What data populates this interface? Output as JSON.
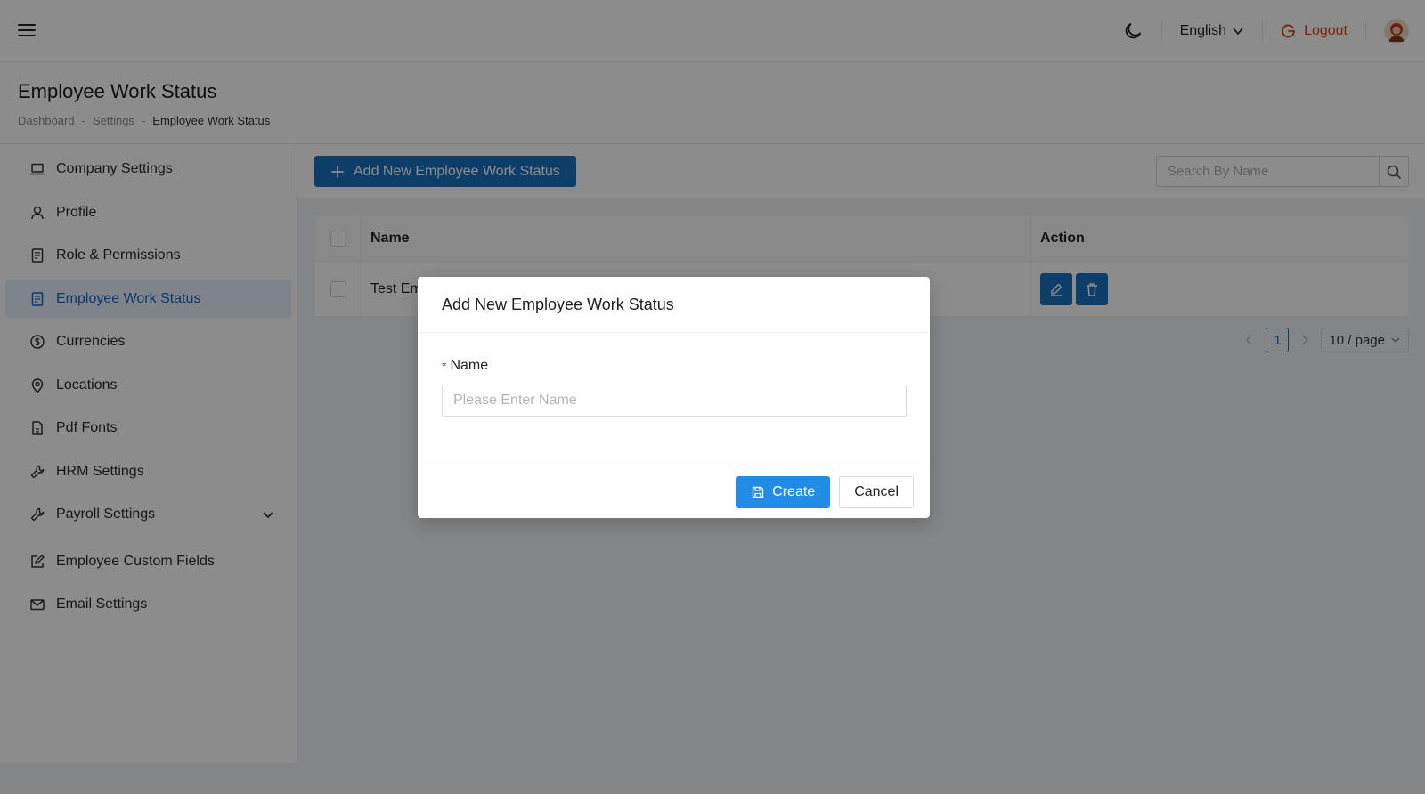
{
  "header": {
    "language": "English",
    "logout_label": "Logout"
  },
  "page": {
    "title": "Employee Work Status",
    "breadcrumb": [
      "Dashboard",
      "Settings",
      "Employee Work Status"
    ]
  },
  "sidebar": {
    "items": [
      {
        "label": "Company Settings",
        "icon": "laptop-icon"
      },
      {
        "label": "Profile",
        "icon": "user-icon"
      },
      {
        "label": "Role & Permissions",
        "icon": "document-icon"
      },
      {
        "label": "Employee Work Status",
        "icon": "document-icon",
        "active": true
      },
      {
        "label": "Currencies",
        "icon": "dollar-icon"
      },
      {
        "label": "Locations",
        "icon": "location-pin-icon"
      },
      {
        "label": "Pdf Fonts",
        "icon": "file-icon"
      },
      {
        "label": "HRM Settings",
        "icon": "tool-icon"
      },
      {
        "label": "Payroll Settings",
        "icon": "tool-icon",
        "expandable": true
      },
      {
        "label": "Employee Custom Fields",
        "icon": "edit-square-icon"
      },
      {
        "label": "Email Settings",
        "icon": "mail-icon"
      }
    ]
  },
  "toolbar": {
    "add_label": "Add New Employee Work Status",
    "search_placeholder": "Search By Name"
  },
  "table": {
    "columns": [
      "Name",
      "Action"
    ],
    "rows": [
      {
        "name": "Test Em"
      }
    ]
  },
  "pagination": {
    "current_page": "1",
    "page_size": "10 / page"
  },
  "modal": {
    "title": "Add New Employee Work Status",
    "name_label": "Name",
    "required_mark": "*",
    "name_placeholder": "Please Enter Name",
    "create_label": "Create",
    "cancel_label": "Cancel"
  },
  "colors": {
    "primary": "#1971c2",
    "create_button": "#228be6",
    "logout": "#d9480f",
    "active_bg": "#e6f0fb"
  }
}
